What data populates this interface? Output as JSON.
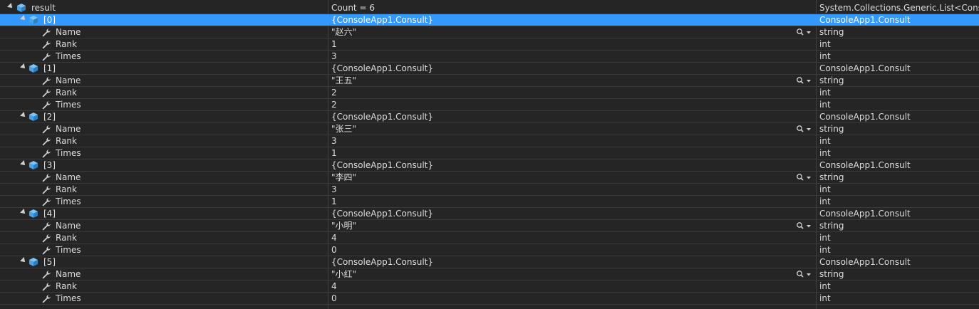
{
  "root": {
    "name": "result",
    "value": "Count = 6",
    "type": "System.Collections.Generic.List<Consol..."
  },
  "items": [
    {
      "index": "[0]",
      "value": "{ConsoleApp1.Consult}",
      "type": "ConsoleApp1.Consult",
      "props": [
        {
          "name": "Name",
          "value": "\"赵六\"",
          "type": "string"
        },
        {
          "name": "Rank",
          "value": "1",
          "type": "int"
        },
        {
          "name": "Times",
          "value": "3",
          "type": "int"
        }
      ]
    },
    {
      "index": "[1]",
      "value": "{ConsoleApp1.Consult}",
      "type": "ConsoleApp1.Consult",
      "props": [
        {
          "name": "Name",
          "value": "\"王五\"",
          "type": "string"
        },
        {
          "name": "Rank",
          "value": "2",
          "type": "int"
        },
        {
          "name": "Times",
          "value": "2",
          "type": "int"
        }
      ]
    },
    {
      "index": "[2]",
      "value": "{ConsoleApp1.Consult}",
      "type": "ConsoleApp1.Consult",
      "props": [
        {
          "name": "Name",
          "value": "\"张三\"",
          "type": "string"
        },
        {
          "name": "Rank",
          "value": "3",
          "type": "int"
        },
        {
          "name": "Times",
          "value": "1",
          "type": "int"
        }
      ]
    },
    {
      "index": "[3]",
      "value": "{ConsoleApp1.Consult}",
      "type": "ConsoleApp1.Consult",
      "props": [
        {
          "name": "Name",
          "value": "\"李四\"",
          "type": "string"
        },
        {
          "name": "Rank",
          "value": "3",
          "type": "int"
        },
        {
          "name": "Times",
          "value": "1",
          "type": "int"
        }
      ]
    },
    {
      "index": "[4]",
      "value": "{ConsoleApp1.Consult}",
      "type": "ConsoleApp1.Consult",
      "props": [
        {
          "name": "Name",
          "value": "\"小明\"",
          "type": "string"
        },
        {
          "name": "Rank",
          "value": "4",
          "type": "int"
        },
        {
          "name": "Times",
          "value": "0",
          "type": "int"
        }
      ]
    },
    {
      "index": "[5]",
      "value": "{ConsoleApp1.Consult}",
      "type": "ConsoleApp1.Consult",
      "props": [
        {
          "name": "Name",
          "value": "\"小红\"",
          "type": "string"
        },
        {
          "name": "Rank",
          "value": "4",
          "type": "int"
        },
        {
          "name": "Times",
          "value": "0",
          "type": "int"
        }
      ]
    }
  ],
  "selected_row": "items.0",
  "colors": {
    "background": "#252526",
    "selection": "#3399ff",
    "object_icon": "#4aa3e8",
    "property_icon": "#d4d4d4"
  },
  "icons": {
    "object": "cube-icon",
    "property": "wrench-icon",
    "expander": "expander-triangle-icon",
    "visualizer": "magnifier-icon"
  }
}
